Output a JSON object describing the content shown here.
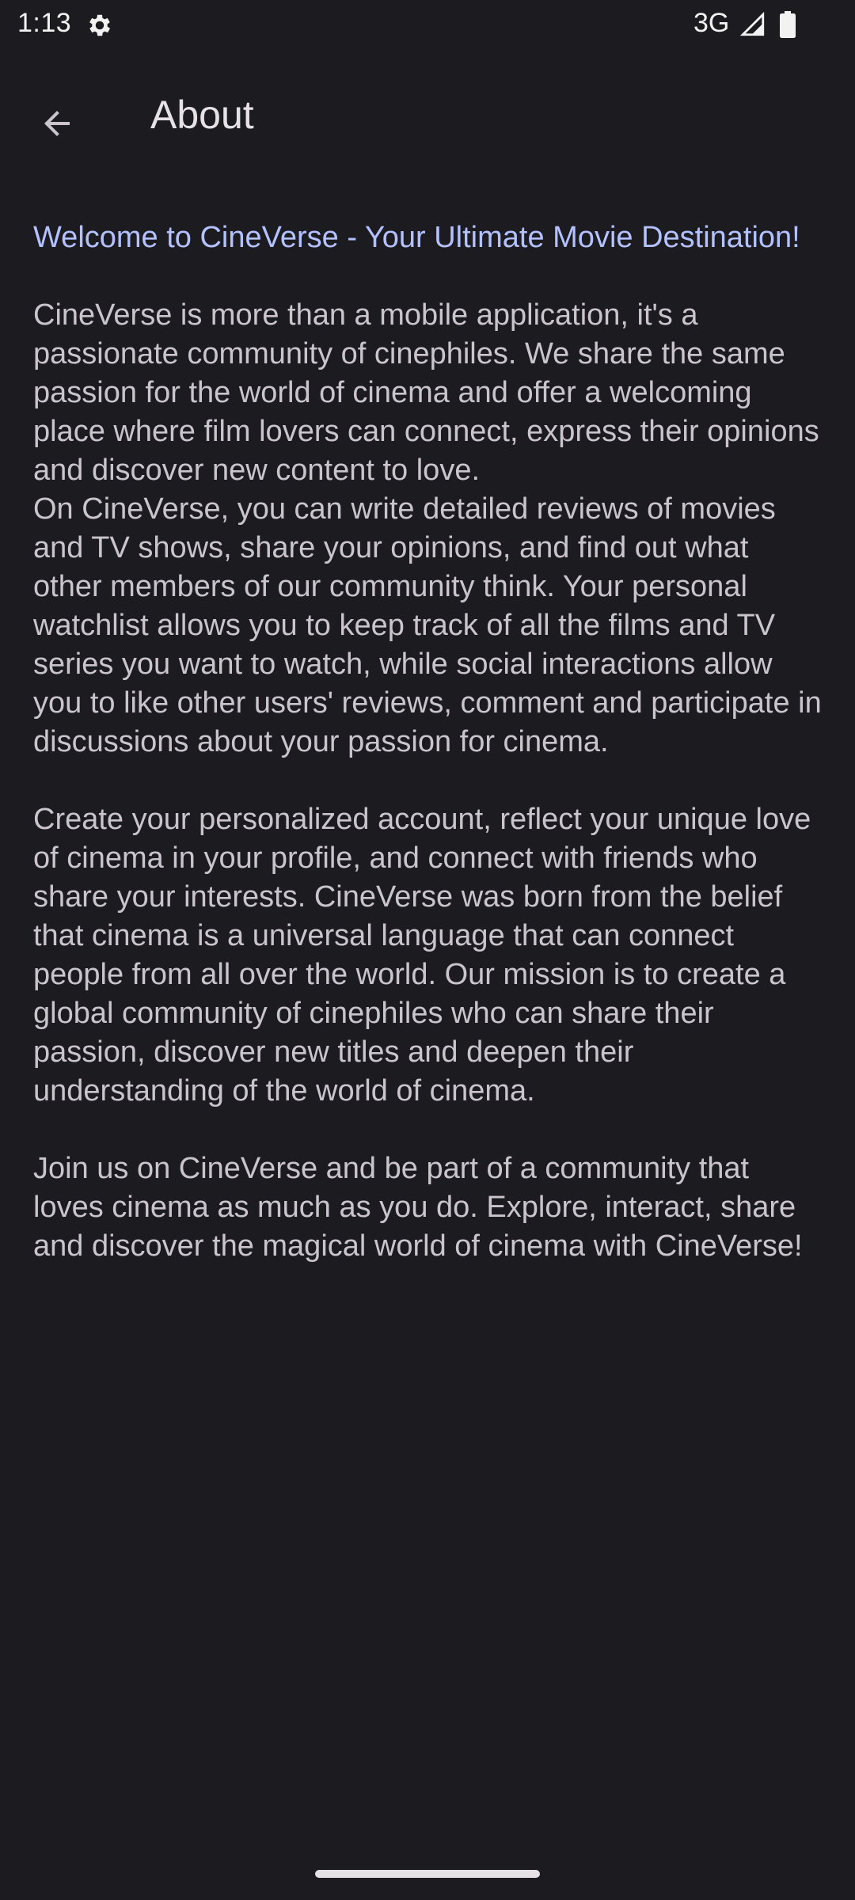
{
  "status_bar": {
    "time": "1:13",
    "network": "3G",
    "icons": [
      "gear-icon",
      "signal-icon",
      "battery-icon"
    ]
  },
  "app_bar": {
    "back_icon": "arrow-back-icon",
    "title": "About"
  },
  "content": {
    "headline": "Welcome to CineVerse - Your Ultimate Movie Destination!",
    "paragraphs": [
      "CineVerse is more than a mobile application, it's a passionate community of cinephiles. We share the same passion for the world of cinema and offer a welcoming place where film lovers can connect, express their opinions and discover new content to love.",
      "On CineVerse, you can write detailed reviews of movies and TV shows, share your opinions, and find out what other members of our community think. Your personal watchlist allows you to keep track of all the films and TV series you want to watch, while social interactions allow you to like other users' reviews, comment and participate in discussions about your passion for cinema.",
      "Create your personalized account, reflect your unique love of cinema in your profile, and connect with friends who share your interests. CineVerse was born from the belief that cinema is a universal language that can connect people from all over the world. Our mission is to create a global community of cinephiles who can share their passion, discover new titles and deepen their understanding of the world of cinema.",
      "Join us on CineVerse and be part of a community that loves cinema as much as you do. Explore, interact, share and discover the magical world of cinema with CineVerse!"
    ]
  },
  "colors": {
    "background": "#1c1b20",
    "headline": "#b3c1ff",
    "body_text": "#cac5cc",
    "title": "#e6e1e5"
  }
}
